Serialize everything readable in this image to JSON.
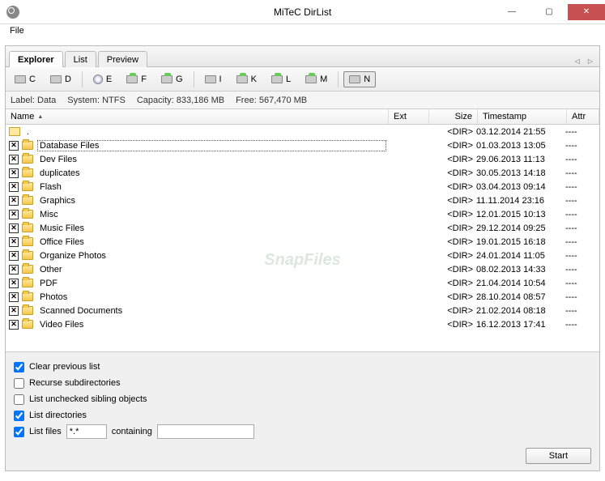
{
  "window": {
    "title": "MiTeC DirList"
  },
  "menubar": {
    "file": "File"
  },
  "tabs": [
    {
      "label": "Explorer",
      "active": true
    },
    {
      "label": "List",
      "active": false
    },
    {
      "label": "Preview",
      "active": false
    }
  ],
  "drives": [
    {
      "letter": "C",
      "kind": "hdd"
    },
    {
      "letter": "D",
      "kind": "hdd"
    },
    {
      "letter": "E",
      "kind": "cd"
    },
    {
      "letter": "F",
      "kind": "ext"
    },
    {
      "letter": "G",
      "kind": "ext"
    },
    {
      "letter": "I",
      "kind": "hdd"
    },
    {
      "letter": "K",
      "kind": "ext"
    },
    {
      "letter": "L",
      "kind": "ext"
    },
    {
      "letter": "M",
      "kind": "ext"
    },
    {
      "letter": "N",
      "kind": "hdd",
      "selected": true
    }
  ],
  "info": {
    "label_lbl": "Label:",
    "label_val": "Data",
    "system_lbl": "System:",
    "system_val": "NTFS",
    "capacity_lbl": "Capacity:",
    "capacity_val": "833,186 MB",
    "free_lbl": "Free:",
    "free_val": "567,470 MB"
  },
  "columns": {
    "name": "Name",
    "ext": "Ext",
    "size": "Size",
    "ts": "Timestamp",
    "attr": "Attr"
  },
  "rows": [
    {
      "up": true,
      "name": ".",
      "ext": "",
      "size": "<DIR>",
      "ts": "03.12.2014 21:55",
      "attr": "----"
    },
    {
      "checked": true,
      "selected": true,
      "name": "Database Files",
      "ext": "",
      "size": "<DIR>",
      "ts": "01.03.2013 13:05",
      "attr": "----"
    },
    {
      "checked": true,
      "name": "Dev Files",
      "ext": "",
      "size": "<DIR>",
      "ts": "29.06.2013 11:13",
      "attr": "----"
    },
    {
      "checked": true,
      "name": "duplicates",
      "ext": "",
      "size": "<DIR>",
      "ts": "30.05.2013 14:18",
      "attr": "----"
    },
    {
      "checked": true,
      "name": "Flash",
      "ext": "",
      "size": "<DIR>",
      "ts": "03.04.2013 09:14",
      "attr": "----"
    },
    {
      "checked": true,
      "name": "Graphics",
      "ext": "",
      "size": "<DIR>",
      "ts": "11.11.2014 23:16",
      "attr": "----"
    },
    {
      "checked": true,
      "name": "Misc",
      "ext": "",
      "size": "<DIR>",
      "ts": "12.01.2015 10:13",
      "attr": "----"
    },
    {
      "checked": true,
      "name": "Music Files",
      "ext": "",
      "size": "<DIR>",
      "ts": "29.12.2014 09:25",
      "attr": "----"
    },
    {
      "checked": true,
      "name": "Office Files",
      "ext": "",
      "size": "<DIR>",
      "ts": "19.01.2015 16:18",
      "attr": "----"
    },
    {
      "checked": true,
      "name": "Organize Photos",
      "ext": "",
      "size": "<DIR>",
      "ts": "24.01.2014 11:05",
      "attr": "----"
    },
    {
      "checked": true,
      "name": "Other",
      "ext": "",
      "size": "<DIR>",
      "ts": "08.02.2013 14:33",
      "attr": "----"
    },
    {
      "checked": true,
      "name": "PDF",
      "ext": "",
      "size": "<DIR>",
      "ts": "21.04.2014 10:54",
      "attr": "----"
    },
    {
      "checked": true,
      "name": "Photos",
      "ext": "",
      "size": "<DIR>",
      "ts": "28.10.2014 08:57",
      "attr": "----"
    },
    {
      "checked": true,
      "name": "Scanned Documents",
      "ext": "",
      "size": "<DIR>",
      "ts": "21.02.2014 08:18",
      "attr": "----"
    },
    {
      "checked": true,
      "name": "Video Files",
      "ext": "",
      "size": "<DIR>",
      "ts": "16.12.2013 17:41",
      "attr": "----"
    }
  ],
  "options": {
    "clear_prev": "Clear previous list",
    "recurse": "Recurse subdirectories",
    "unchecked_siblings": "List unchecked sibling objects",
    "list_dirs": "List directories",
    "list_files": "List files",
    "mask_value": "*.*",
    "containing_lbl": "containing",
    "containing_value": ""
  },
  "buttons": {
    "start": "Start"
  },
  "watermark": "SnapFiles"
}
